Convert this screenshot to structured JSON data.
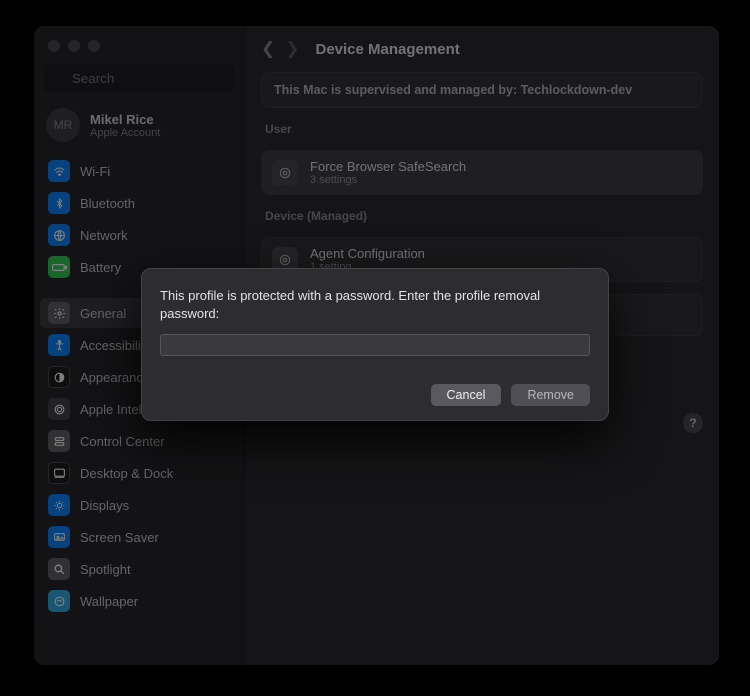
{
  "search": {
    "placeholder": "Search"
  },
  "account": {
    "initials": "MR",
    "name": "Mikel Rice",
    "sub": "Apple Account"
  },
  "sidebar": {
    "items": [
      {
        "label": "Wi-Fi"
      },
      {
        "label": "Bluetooth"
      },
      {
        "label": "Network"
      },
      {
        "label": "Battery"
      },
      {
        "label": "General"
      },
      {
        "label": "Accessibility"
      },
      {
        "label": "Appearance"
      },
      {
        "label": "Apple Intelligence…"
      },
      {
        "label": "Control Center"
      },
      {
        "label": "Desktop & Dock"
      },
      {
        "label": "Displays"
      },
      {
        "label": "Screen Saver"
      },
      {
        "label": "Spotlight"
      },
      {
        "label": "Wallpaper"
      }
    ]
  },
  "page": {
    "title": "Device Management",
    "banner": "This Mac is supervised and managed by: Techlockdown-dev",
    "user_section": "User",
    "device_section": "Device (Managed)",
    "profiles": {
      "user": {
        "title": "Force Browser SafeSearch",
        "sub": "3 settings"
      },
      "device": {
        "title": "Agent Configuration",
        "sub": "1 setting"
      }
    },
    "help": "?"
  },
  "modal": {
    "message": "This profile is protected with a password. Enter the profile removal password:",
    "cancel": "Cancel",
    "remove": "Remove",
    "value": ""
  }
}
